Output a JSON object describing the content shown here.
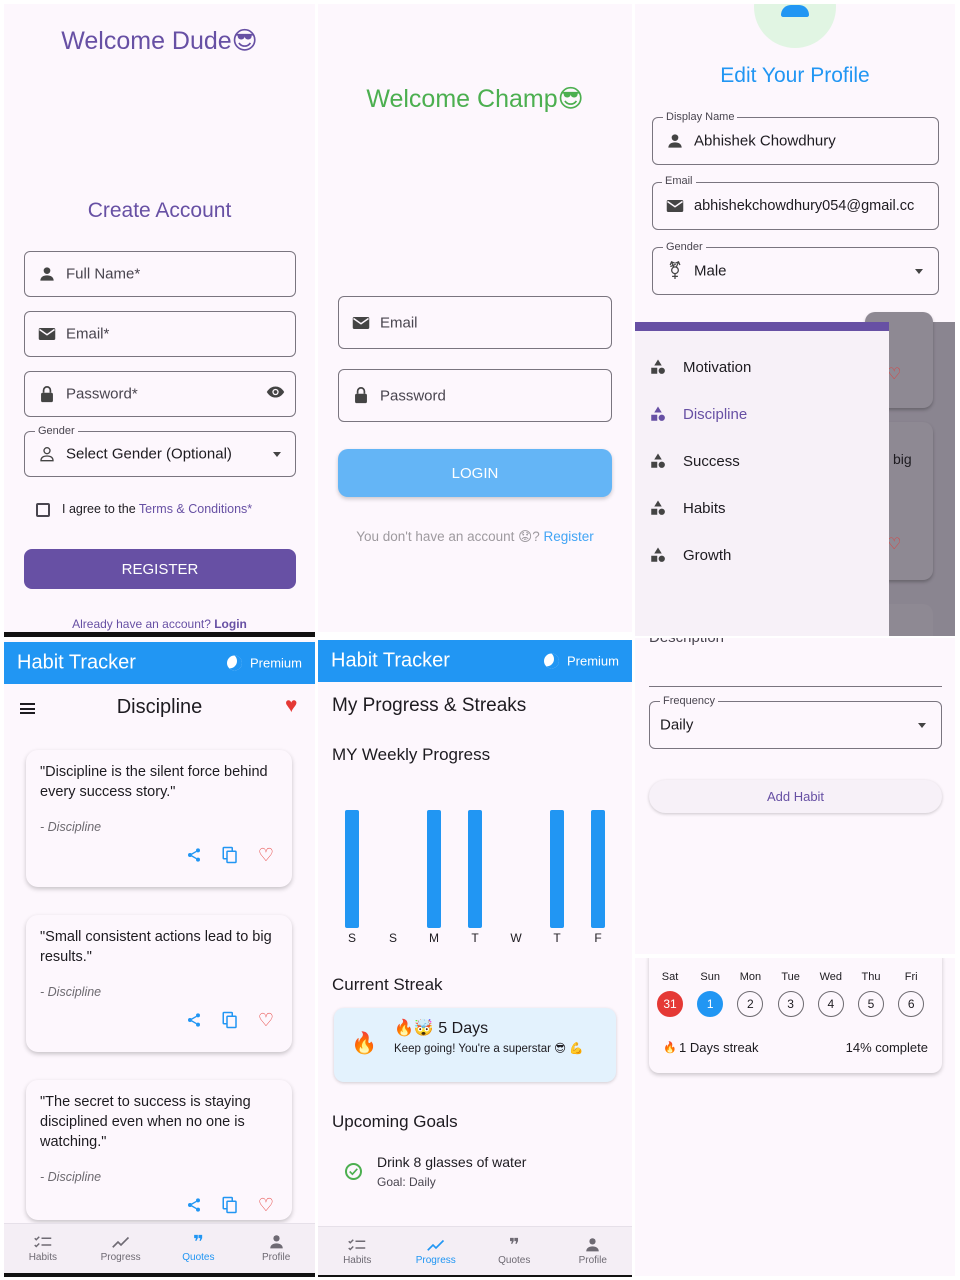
{
  "colors": {
    "purple": "#6750a4",
    "green": "#4caf50",
    "blue": "#2196f3",
    "red": "#e53935",
    "light_blue_button": "#64b5f6"
  },
  "signup": {
    "welcome": "Welcome Dude😎",
    "heading": "Create Account",
    "full_name_placeholder": "Full Name*",
    "email_placeholder": "Email*",
    "password_placeholder": "Password*",
    "gender_label": "Gender",
    "gender_value": "Select Gender (Optional)",
    "agree_prefix": "I agree to the ",
    "agree_link": "Terms & Conditions*",
    "register_button": "REGISTER",
    "login_prompt": "Already have an account? ",
    "login_link": "Login"
  },
  "login": {
    "welcome": "Welcome Champ😎",
    "email_placeholder": "Email",
    "password_placeholder": "Password",
    "login_button": "LOGIN",
    "no_account_prompt": "You don't have an account 😟? ",
    "register_link": "Register"
  },
  "profile": {
    "title": "Edit Your Profile",
    "display_name_label": "Display Name",
    "display_name_value": "Abhishek Chowdhury",
    "email_label": "Email",
    "email_value": "abhishekchowdhury054@gmail.cc",
    "gender_label": "Gender",
    "gender_value": "Male"
  },
  "drawer": {
    "items": [
      {
        "label": "Motivation"
      },
      {
        "label": "Discipline"
      },
      {
        "label": "Success"
      },
      {
        "label": "Habits"
      },
      {
        "label": "Growth"
      }
    ],
    "behind_text": "big",
    "behind_text2": "Description"
  },
  "quotes_screen": {
    "app_title": "Habit Tracker",
    "premium": "Premium",
    "category_title": "Discipline",
    "quotes": [
      {
        "text": "\"Discipline is the silent force behind every success story.\"",
        "source": "- Discipline"
      },
      {
        "text": "\"Small consistent actions lead to big results.\"",
        "source": "- Discipline"
      },
      {
        "text": "\"The secret to success is staying disciplined even when no one is watching.\"",
        "source": "- Discipline"
      }
    ]
  },
  "progress_screen": {
    "app_title": "Habit Tracker",
    "premium": "Premium",
    "title": "My Progress & Streaks",
    "weekly_title": "MY Weekly Progress",
    "streak_title": "Current Streak",
    "streak_emoji": "🔥🤯",
    "streak_value": "5 Days",
    "streak_message": "Keep going! You're a superstar 😎 💪",
    "goals_title": "Upcoming Goals",
    "goal_name": "Drink 8 glasses of water",
    "goal_freq": "Goal: Daily"
  },
  "chart_data": {
    "type": "bar",
    "categories": [
      "S",
      "S",
      "M",
      "T",
      "W",
      "T",
      "F"
    ],
    "values": [
      1,
      0,
      1,
      1,
      0,
      1,
      1
    ],
    "ylim": [
      0,
      1
    ],
    "grid": false,
    "title": "MY Weekly Progress"
  },
  "nav": {
    "items": [
      {
        "label": "Habits",
        "icon": "checklist-icon"
      },
      {
        "label": "Progress",
        "icon": "trending-up-icon"
      },
      {
        "label": "Quotes",
        "icon": "quote-icon"
      },
      {
        "label": "Profile",
        "icon": "person-icon"
      }
    ]
  },
  "add_habit": {
    "partial_label": "Description",
    "frequency_label": "Frequency",
    "frequency_value": "Daily",
    "add_button": "Add Habit"
  },
  "calendar": {
    "days": [
      "Sat",
      "Sun",
      "Mon",
      "Tue",
      "Wed",
      "Thu",
      "Fri"
    ],
    "dates": [
      "31",
      "1",
      "2",
      "3",
      "4",
      "5",
      "6"
    ],
    "streak": "1 Days streak",
    "complete": "14% complete"
  }
}
